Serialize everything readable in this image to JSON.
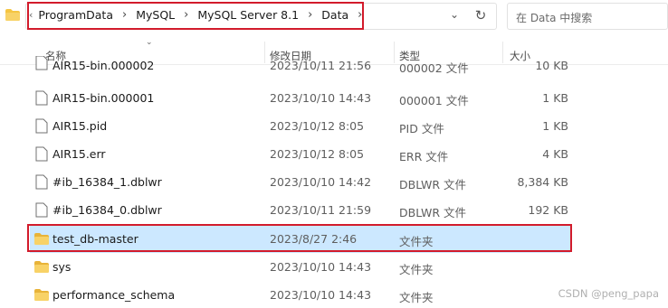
{
  "address_bar": {
    "crumbs": [
      "ProgramData",
      "MySQL",
      "MySQL Server 8.1",
      "Data"
    ]
  },
  "search": {
    "placeholder": "在 Data 中搜索"
  },
  "columns": {
    "name": "名称",
    "date": "修改日期",
    "type": "类型",
    "size": "大小"
  },
  "files": [
    {
      "name": "AIR15-bin.000002",
      "date": "2023/10/11 21:56",
      "type": "000002 文件",
      "size": "10 KB",
      "kind": "file"
    },
    {
      "name": "AIR15-bin.000001",
      "date": "2023/10/10 14:43",
      "type": "000001 文件",
      "size": "1 KB",
      "kind": "file"
    },
    {
      "name": "AIR15.pid",
      "date": "2023/10/12 8:05",
      "type": "PID 文件",
      "size": "1 KB",
      "kind": "file"
    },
    {
      "name": "AIR15.err",
      "date": "2023/10/12 8:05",
      "type": "ERR 文件",
      "size": "4 KB",
      "kind": "file"
    },
    {
      "name": "#ib_16384_1.dblwr",
      "date": "2023/10/10 14:42",
      "type": "DBLWR 文件",
      "size": "8,384 KB",
      "kind": "file"
    },
    {
      "name": "#ib_16384_0.dblwr",
      "date": "2023/10/11 21:59",
      "type": "DBLWR 文件",
      "size": "192 KB",
      "kind": "file"
    },
    {
      "name": "test_db-master",
      "date": "2023/8/27 2:46",
      "type": "文件夹",
      "size": "",
      "kind": "folder"
    },
    {
      "name": "sys",
      "date": "2023/10/10 14:43",
      "type": "文件夹",
      "size": "",
      "kind": "folder"
    },
    {
      "name": "performance_schema",
      "date": "2023/10/10 14:43",
      "type": "文件夹",
      "size": "",
      "kind": "folder"
    }
  ],
  "selected_file": "test_db-master",
  "watermark": "CSDN @peng_papa",
  "colors": {
    "selection": "#cce8ff",
    "highlight_border": "#d21b2b",
    "folder": "#f5c542"
  },
  "icons": [
    "folder-icon",
    "chevron-right-icon",
    "chevron-down-icon",
    "refresh-icon",
    "file-icon"
  ]
}
